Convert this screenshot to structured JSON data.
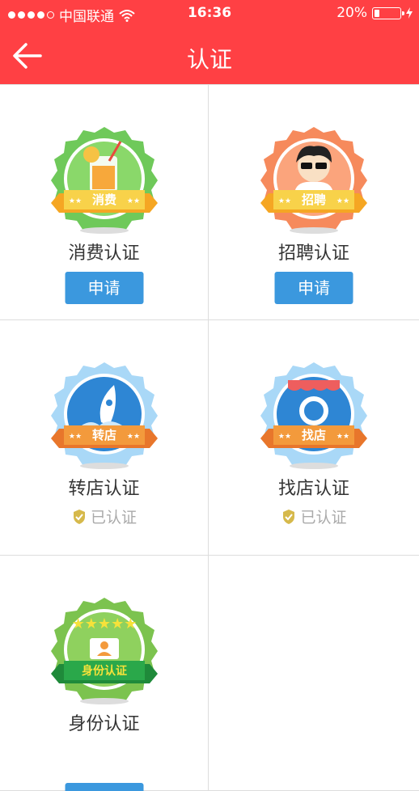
{
  "status_bar": {
    "carrier": "中国联通",
    "time": "16:36",
    "battery": "20%"
  },
  "nav": {
    "title": "认证"
  },
  "cards": [
    {
      "title": "消费认证",
      "ribbon": "消费",
      "action": "申请"
    },
    {
      "title": "招聘认证",
      "ribbon": "招聘",
      "action": "申请"
    },
    {
      "title": "转店认证",
      "ribbon": "转店",
      "status": "已认证"
    },
    {
      "title": "找店认证",
      "ribbon": "找店",
      "status": "已认证"
    },
    {
      "title": "身份认证",
      "ribbon": "身份认证"
    }
  ],
  "colors": {
    "primary": "#ff4044",
    "button": "#3b98de",
    "verified_icon": "#d6b94b"
  }
}
